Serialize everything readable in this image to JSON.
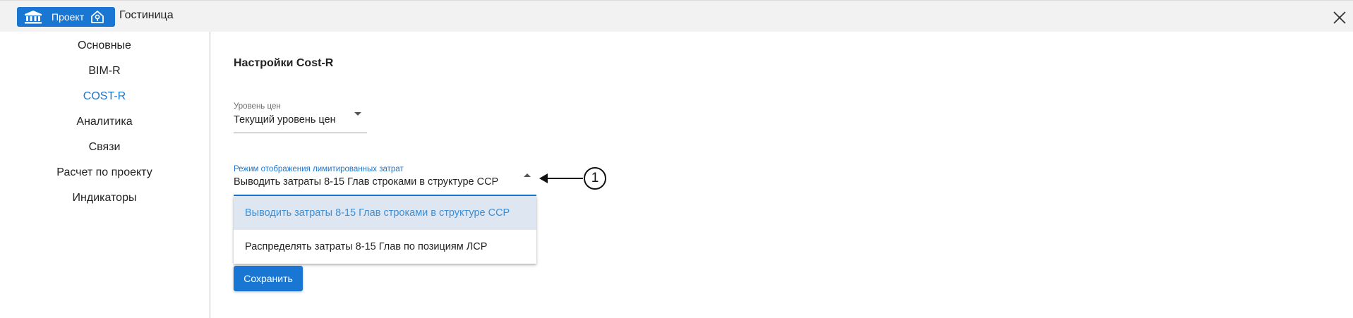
{
  "header": {
    "project_button_label": "Проект",
    "project_name": "Гостиница"
  },
  "sidebar": {
    "items": [
      {
        "label": "Основные",
        "active": false
      },
      {
        "label": "BIM-R",
        "active": false
      },
      {
        "label": "COST-R",
        "active": true
      },
      {
        "label": "Аналитика",
        "active": false
      },
      {
        "label": "Связи",
        "active": false
      },
      {
        "label": "Расчет по проекту",
        "active": false
      },
      {
        "label": "Индикаторы",
        "active": false
      }
    ]
  },
  "main": {
    "title": "Настройки Cost-R",
    "price_level": {
      "label": "Уровень цен",
      "value": "Текущий уровень цен"
    },
    "display_mode": {
      "label": "Режим отображения лимитированных затрат",
      "value": "Выводить затраты 8-15 Глав строками в структуре ССР",
      "options": [
        {
          "label": "Выводить затраты 8-15 Глав строками в структуре ССР",
          "selected": true
        },
        {
          "label": "Распределять затраты 8-15 Глав по позициям ЛСР",
          "selected": false
        }
      ]
    },
    "callout_number": "1",
    "save_label": "Сохранить"
  },
  "colors": {
    "accent": "#1976d2",
    "selected_option_bg": "#dde6f1",
    "selected_option_text": "#3d8fd6",
    "header_bg": "#f2f2f2"
  },
  "icons": [
    "bank-icon",
    "home-icon",
    "close-icon",
    "chevron-down-icon",
    "chevron-up-icon",
    "arrow-left-icon"
  ]
}
